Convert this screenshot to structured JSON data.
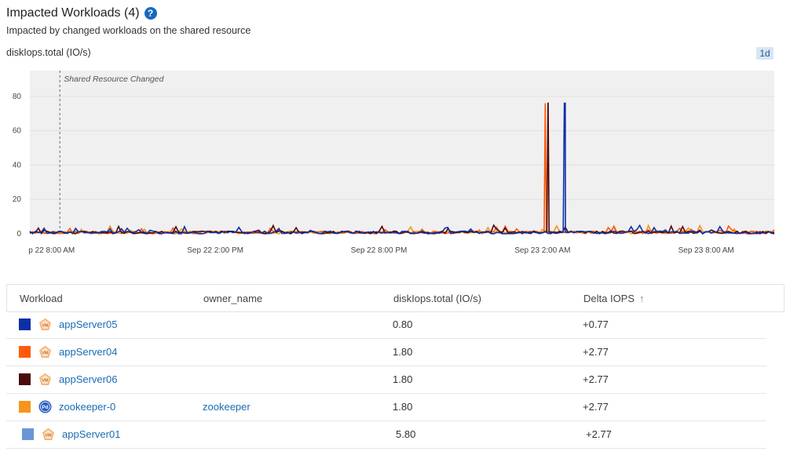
{
  "header": {
    "title": "Impacted Workloads (4)",
    "help_icon": "question-circle-icon",
    "subtitle": "Impacted by changed workloads on the shared resource",
    "metric": "diskIops.total (IO/s)",
    "range": "1d"
  },
  "chart_data": {
    "type": "line",
    "annotation": "Shared Resource Changed",
    "yticks": [
      "0",
      "20",
      "40",
      "60",
      "80"
    ],
    "ylim": [
      0,
      95
    ],
    "xticks": [
      "p 22 8:00 AM",
      "Sep 22 2:00 PM",
      "Sep 22 8:00 PM",
      "Sep 23 2:00 AM",
      "Sep 23 8:00 AM"
    ],
    "x_unit": "hours from Sep 22 8:00 AM",
    "xlim": [
      -0.8,
      26.5
    ],
    "annotation_x": 0.3,
    "grid": true,
    "series": [
      {
        "name": "appServer05",
        "color": "#0b2fa8",
        "spike_x": 18.8,
        "spike_value": 76
      },
      {
        "name": "appServer04",
        "color": "#ff5a0a",
        "spike_x": 18.1,
        "spike_value": 76
      },
      {
        "name": "appServer06",
        "color": "#4a0b0b",
        "spike_x": 18.2,
        "spike_value": 76
      },
      {
        "name": "zookeeper-0",
        "color": "#f7941d",
        "spike_x": null,
        "spike_value": null
      }
    ]
  },
  "table": {
    "columns": [
      "Workload",
      "owner_name",
      "diskIops.total (IO/s)",
      "Delta IOPS"
    ],
    "sort_icon": "arrow-up-icon",
    "rows": [
      {
        "color": "#0b2fa8",
        "icon": "vm-icon",
        "icon_text": "VM",
        "workload": "appServer05",
        "owner": "",
        "iops": "0.80",
        "delta": "+0.77"
      },
      {
        "color": "#ff5a0a",
        "icon": "vm-icon",
        "icon_text": "VM",
        "workload": "appServer04",
        "owner": "",
        "iops": "1.80",
        "delta": "+2.77"
      },
      {
        "color": "#4a0b0b",
        "icon": "vm-icon",
        "icon_text": "VM",
        "workload": "appServer06",
        "owner": "",
        "iops": "1.80",
        "delta": "+2.77"
      },
      {
        "color": "#f7941d",
        "icon": "pod-icon",
        "icon_text": "Pd",
        "workload": "zookeeper-0",
        "owner": "zookeeper",
        "iops": "1.80",
        "delta": "+2.77"
      },
      {
        "color": "#6a96d6",
        "icon": "vm-icon",
        "icon_text": "VM",
        "workload": "appServer01",
        "owner": "",
        "iops": "5.80",
        "delta": "+2.77"
      }
    ]
  }
}
